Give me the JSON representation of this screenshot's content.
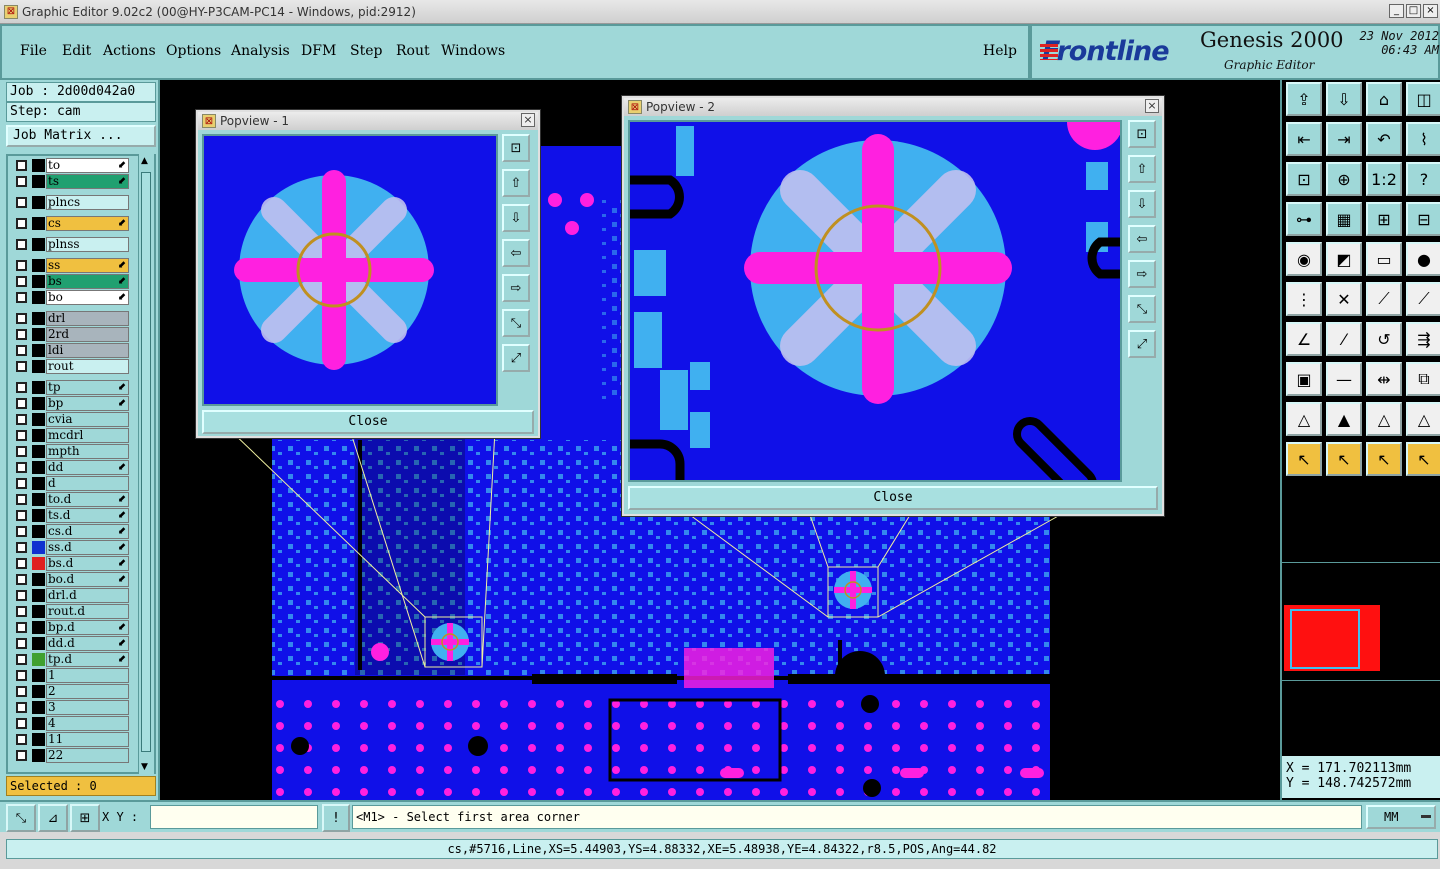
{
  "window": {
    "title": "Graphic Editor 9.02c2 (00@HY-P3CAM-PC14 - Windows, pid:2912)"
  },
  "menubar": {
    "items": [
      "File",
      "Edit",
      "Actions",
      "Options",
      "Analysis",
      "DFM",
      "Step",
      "Rout",
      "Windows"
    ],
    "help": "Help"
  },
  "branding": {
    "company": "Frontline",
    "product": "Genesis 2000",
    "subtitle": "Graphic Editor",
    "date": "23 Nov 2012",
    "time": "06:43 AM"
  },
  "job": {
    "label": "Job : 2d00d042a0",
    "step": "Step: cam",
    "matrix_button": "Job Matrix ..."
  },
  "layers": [
    {
      "name": "to",
      "bg": "#ffffff",
      "color": "#000000",
      "arrow": true
    },
    {
      "name": "ts",
      "bg": "#20a070",
      "color": "#000000",
      "arrow": true
    },
    {
      "name": "plncs",
      "bg": "#c9f0f0",
      "color": "#000000",
      "arrow": false
    },
    {
      "name": "cs",
      "bg": "#f0c040",
      "color": "#000000",
      "arrow": true
    },
    {
      "name": "plnss",
      "bg": "#c9f0f0",
      "color": "#000000",
      "arrow": false
    },
    {
      "name": "ss",
      "bg": "#f0c040",
      "color": "#000000",
      "arrow": true
    },
    {
      "name": "bs",
      "bg": "#20a070",
      "color": "#000000",
      "arrow": true
    },
    {
      "name": "bo",
      "bg": "#ffffff",
      "color": "#000000",
      "arrow": true
    },
    {
      "name": "drl",
      "bg": "#a8b4bc",
      "color": "#000000",
      "arrow": false
    },
    {
      "name": "2rd",
      "bg": "#a8b4bc",
      "color": "#000000",
      "arrow": false
    },
    {
      "name": "ldi",
      "bg": "#a8b4bc",
      "color": "#000000",
      "arrow": false
    },
    {
      "name": "rout",
      "bg": "#c9f0f0",
      "color": "#000000",
      "arrow": false
    },
    {
      "name": "tp",
      "bg": "#9fd8d8",
      "color": "#000000",
      "arrow": true
    },
    {
      "name": "bp",
      "bg": "#9fd8d8",
      "color": "#000000",
      "arrow": true
    },
    {
      "name": "cvia",
      "bg": "#9fd8d8",
      "color": "#000000",
      "arrow": false
    },
    {
      "name": "mcdrl",
      "bg": "#9fd8d8",
      "color": "#000000",
      "arrow": false
    },
    {
      "name": "mpth",
      "bg": "#9fd8d8",
      "color": "#000000",
      "arrow": false
    },
    {
      "name": "dd",
      "bg": "#9fd8d8",
      "color": "#000000",
      "arrow": true
    },
    {
      "name": "d",
      "bg": "#9fd8d8",
      "color": "#000000",
      "arrow": false
    },
    {
      "name": "to.d",
      "bg": "#9fd8d8",
      "color": "#000000",
      "arrow": true
    },
    {
      "name": "ts.d",
      "bg": "#9fd8d8",
      "color": "#000000",
      "arrow": true
    },
    {
      "name": "cs.d",
      "bg": "#9fd8d8",
      "color": "#000000",
      "arrow": true
    },
    {
      "name": "ss.d",
      "bg": "#9fd8d8",
      "color": "#1030d0",
      "arrow": true
    },
    {
      "name": "bs.d",
      "bg": "#9fd8d8",
      "color": "#e02020",
      "arrow": true
    },
    {
      "name": "bo.d",
      "bg": "#9fd8d8",
      "color": "#000000",
      "arrow": true
    },
    {
      "name": "drl.d",
      "bg": "#9fd8d8",
      "color": "#000000",
      "arrow": false
    },
    {
      "name": "rout.d",
      "bg": "#9fd8d8",
      "color": "#000000",
      "arrow": false
    },
    {
      "name": "bp.d",
      "bg": "#9fd8d8",
      "color": "#000000",
      "arrow": true
    },
    {
      "name": "dd.d",
      "bg": "#9fd8d8",
      "color": "#000000",
      "arrow": true
    },
    {
      "name": "tp.d",
      "bg": "#9fd8d8",
      "color": "#40a030",
      "arrow": true
    },
    {
      "name": "1",
      "bg": "#9fd8d8",
      "color": "#000000",
      "arrow": false
    },
    {
      "name": "2",
      "bg": "#9fd8d8",
      "color": "#000000",
      "arrow": false
    },
    {
      "name": "3",
      "bg": "#9fd8d8",
      "color": "#000000",
      "arrow": false
    },
    {
      "name": "4",
      "bg": "#9fd8d8",
      "color": "#000000",
      "arrow": false
    },
    {
      "name": "11",
      "bg": "#9fd8d8",
      "color": "#000000",
      "arrow": false
    },
    {
      "name": "22",
      "bg": "#9fd8d8",
      "color": "#000000",
      "arrow": false
    }
  ],
  "selected": "Selected : 0",
  "popview1": {
    "title": "Popview - 1",
    "close": "Close"
  },
  "popview2": {
    "title": "Popview - 2",
    "close": "Close"
  },
  "coords": {
    "x": "X =  171.702113mm",
    "y": "Y =  148.742572mm"
  },
  "bottom": {
    "xy_label": "X Y :",
    "prompt": "<M1> - Select first area corner",
    "units": "MM"
  },
  "status": "cs,#5716,Line,XS=5.44903,YS=4.88332,XE=5.48938,YE=4.84322,r8.5,POS,Ang=44.82",
  "colors": {
    "board": "#1010e8",
    "pad": "#ff20e0",
    "copper": "#40b0f0",
    "panel": "#9fd8d8"
  }
}
